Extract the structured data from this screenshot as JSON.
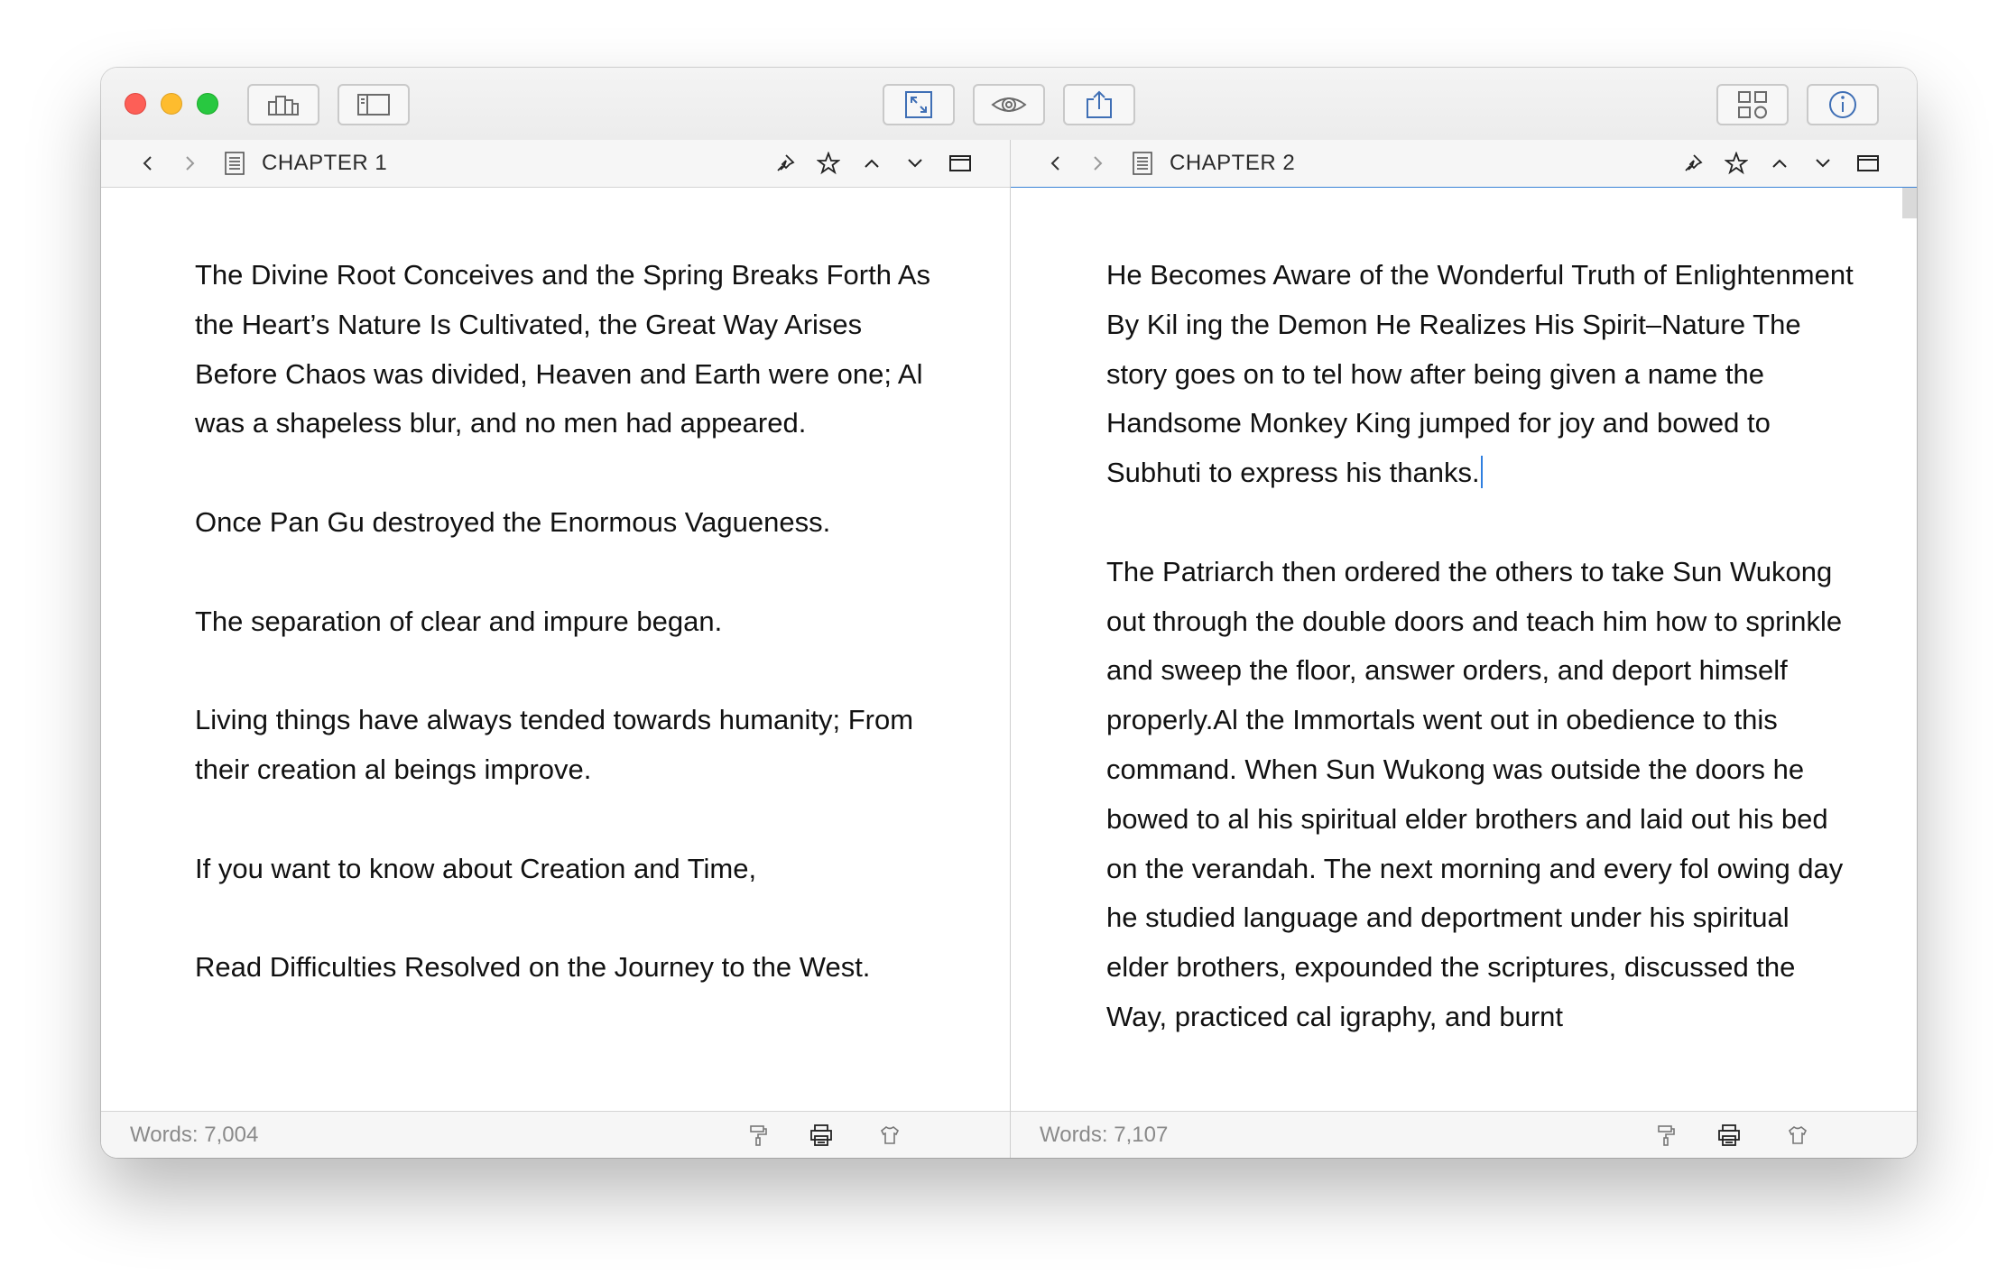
{
  "toolbar": {
    "buttons": [
      {
        "id": "binder",
        "icon": "building-icon"
      },
      {
        "id": "sidebar",
        "icon": "sidebar-icon"
      },
      {
        "id": "composition",
        "icon": "expand-arrows-icon"
      },
      {
        "id": "preview",
        "icon": "eye-icon"
      },
      {
        "id": "export",
        "icon": "share-icon"
      },
      {
        "id": "grid",
        "icon": "grid-shapes-icon"
      },
      {
        "id": "info",
        "icon": "info-icon"
      }
    ]
  },
  "left_pane": {
    "chapter_title": "CHAPTER 1",
    "paragraphs": [
      "The Divine Root Conceives and the Spring Breaks Forth As the Heart’s Nature Is Cultivated, the Great Way Arises Before Chaos was divided, Heaven and Earth were one; Al was a shapeless blur, and no men had appeared.",
      "Once Pan Gu destroyed the Enormous Vagueness.",
      "The separation of clear and impure began.",
      "Living things have always tended towards humanity; From their creation al beings improve.",
      "If you want to know about Creation and Time,",
      "Read Difficulties Resolved on the Journey to the West."
    ],
    "word_count": "Words: 7,004"
  },
  "right_pane": {
    "chapter_title": "CHAPTER 2",
    "paragraphs": [
      "He Becomes Aware of the Wonderful Truth of Enlightenment By Kil ing the Demon He Realizes His Spirit–Nature The story goes on to tel how after being given a name the Handsome Monkey King jumped for joy and bowed to Subhuti to express his thanks.",
      "The Patriarch then ordered the others to take Sun Wukong out through the double doors and teach him how to sprinkle and sweep the floor, answer orders, and deport himself properly.Al the Immortals went out in obedience to this command. When Sun Wukong was outside the doors he bowed to al his spiritual elder brothers and laid out his bed on the verandah. The next morning and every fol owing day he studied language and deportment under his spiritual elder brothers, expounded the scriptures, discussed the Way, practiced cal igraphy, and burnt"
    ],
    "word_count": "Words: 7,107"
  },
  "colors": {
    "accent": "#3b83d6",
    "caret": "#2f7fe0",
    "close": "#fd5f57",
    "minimize": "#febc2e",
    "maximize": "#28c840"
  }
}
